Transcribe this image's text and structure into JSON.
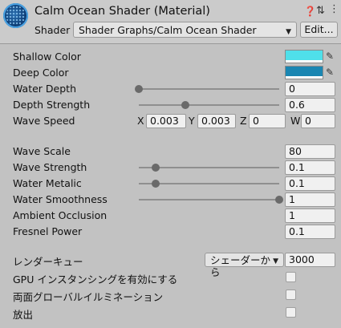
{
  "header": {
    "title": "Calm Ocean Shader (Material)",
    "shader_label": "Shader",
    "shader_value": "Shader Graphs/Calm Ocean Shader",
    "edit_button": "Edit..."
  },
  "properties": {
    "shallow_color": {
      "label": "Shallow Color",
      "color": "#4fe0ea"
    },
    "deep_color": {
      "label": "Deep Color",
      "color": "#1a86b2"
    },
    "water_depth": {
      "label": "Water Depth",
      "value": "0",
      "slider": 0.0
    },
    "depth_strength": {
      "label": "Depth Strength",
      "value": "0.6",
      "slider": 0.33
    },
    "wave_speed": {
      "label": "Wave Speed",
      "x_label": "X",
      "x": "0.003",
      "y_label": "Y",
      "y": "0.003",
      "z_label": "Z",
      "z": "0",
      "w_label": "W",
      "w": "0"
    },
    "wave_scale": {
      "label": "Wave Scale",
      "value": "80"
    },
    "wave_strength": {
      "label": "Wave Strength",
      "value": "0.1",
      "slider": 0.12
    },
    "water_metalic": {
      "label": "Water Metalic",
      "value": "0.1",
      "slider": 0.12
    },
    "water_smoothness": {
      "label": "Water Smoothness",
      "value": "1",
      "slider": 1.0
    },
    "ambient_occlusion": {
      "label": "Ambient Occlusion",
      "value": "1"
    },
    "fresnel_power": {
      "label": "Fresnel Power",
      "value": "0.1"
    }
  },
  "render": {
    "queue_label": "レンダーキュー",
    "queue_dropdown": "シェーダーから",
    "queue_value": "3000",
    "gpu_instancing_label": "GPU インスタンシングを有効にする",
    "double_sided_gi_label": "両面グローバルイルミネーション",
    "emission_label": "放出"
  }
}
